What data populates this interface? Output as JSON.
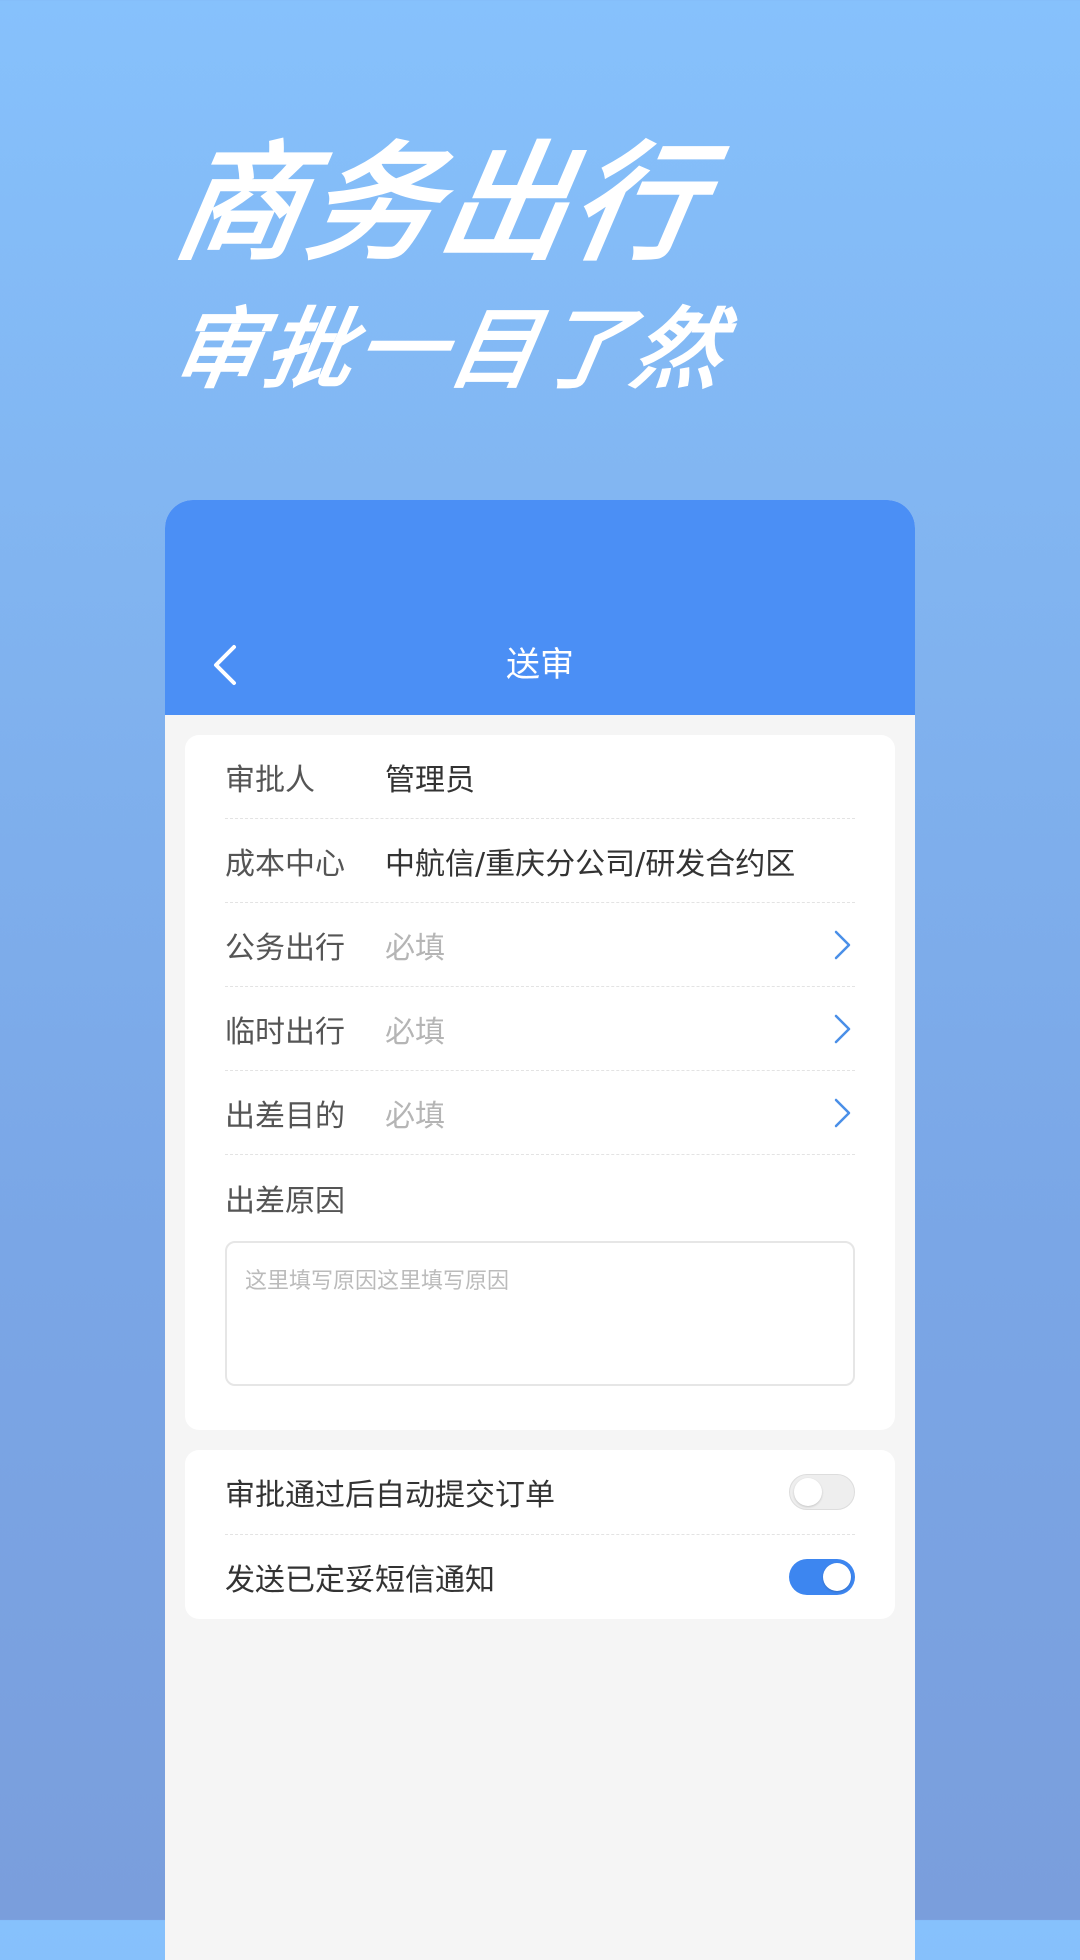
{
  "headline": {
    "line1": "商务出行",
    "line2": "审批一目了然"
  },
  "navbar": {
    "title": "送审",
    "back_icon": "chevron-left-icon"
  },
  "form": {
    "approver": {
      "label": "审批人",
      "value": "管理员"
    },
    "cost_center": {
      "label": "成本中心",
      "value": "中航信/重庆分公司/研发合约区"
    },
    "official_travel": {
      "label": "公务出行",
      "placeholder": "必填"
    },
    "temporary_travel": {
      "label": "临时出行",
      "placeholder": "必填"
    },
    "trip_purpose": {
      "label": "出差目的",
      "placeholder": "必填"
    },
    "trip_reason": {
      "label": "出差原因",
      "placeholder": "这里填写原因这里填写原因"
    }
  },
  "settings": {
    "auto_submit": {
      "label": "审批通过后自动提交订单",
      "enabled": false
    },
    "sms_notify": {
      "label": "发送已定妥短信通知",
      "enabled": true
    }
  },
  "colors": {
    "primary": "#4b8ff5",
    "toggle_on": "#3d86f0",
    "chevron": "#4a8fe8"
  }
}
